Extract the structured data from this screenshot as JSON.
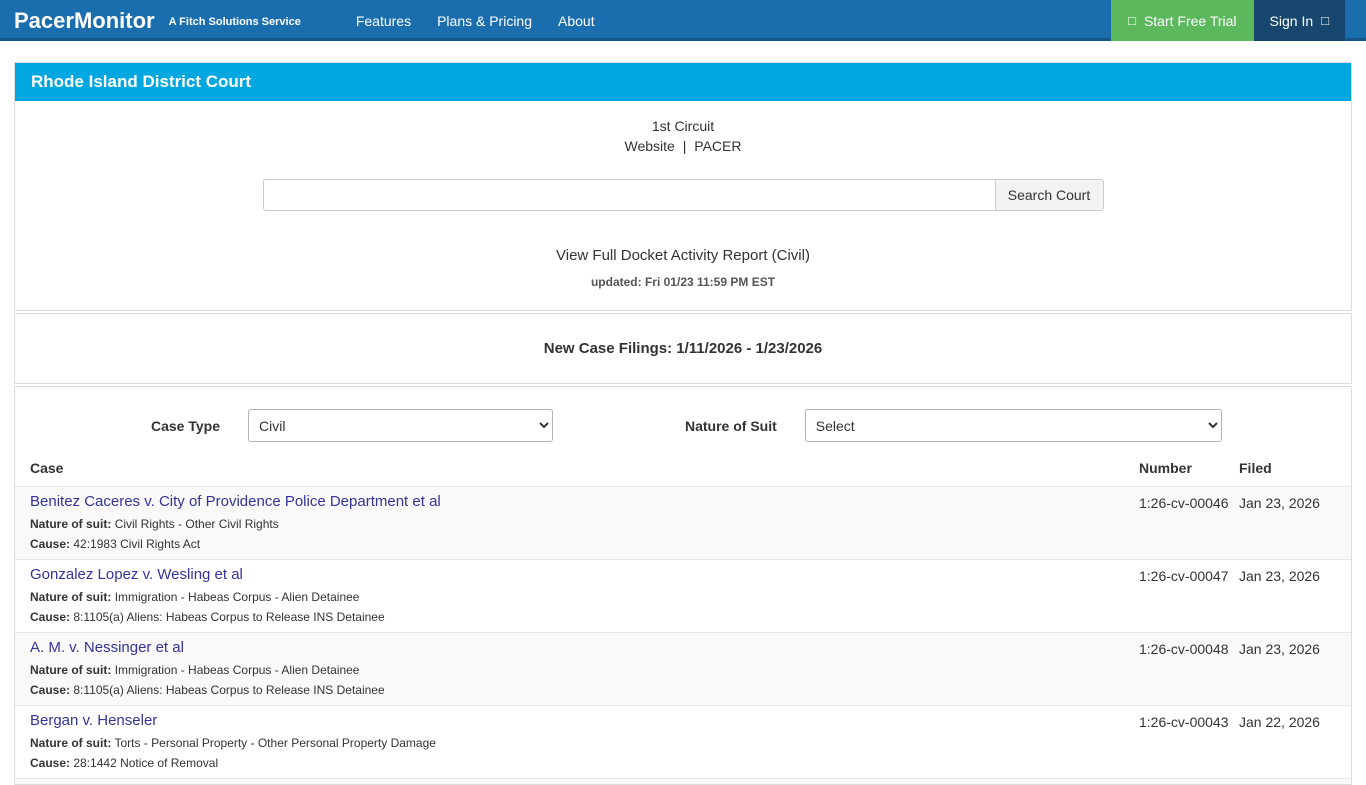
{
  "navbar": {
    "brand": "PacerMonitor",
    "tagline": "A Fitch Solutions Service",
    "links": [
      {
        "label": "Features"
      },
      {
        "label": "Plans & Pricing"
      },
      {
        "label": "About"
      }
    ],
    "trial_icon": "□",
    "trial_label": "Start Free Trial",
    "signin_label": "Sign In",
    "signin_icon": "□"
  },
  "court": {
    "name": "Rhode Island District Court",
    "circuit": "1st Circuit",
    "website_link": "Website",
    "separator": "|",
    "pacer_link": "PACER",
    "search_value": "",
    "search_button": "Search Court",
    "report_link": "View Full Docket Activity Report (Civil)",
    "updated": "updated: Fri 01/23 11:59 PM EST"
  },
  "filings": {
    "heading": "New Case Filings: 1/11/2026 - 1/23/2026",
    "case_type_label": "Case Type",
    "case_type_value": "Civil",
    "nature_label": "Nature of Suit",
    "nature_value": "Select",
    "table": {
      "columns": {
        "case": "Case",
        "number": "Number",
        "filed": "Filed"
      },
      "meta_labels": {
        "nature": "Nature of suit:",
        "cause": "Cause:"
      },
      "rows": [
        {
          "title": "Benitez Caceres v. City of Providence Police Department et al",
          "nature": "Civil Rights - Other Civil Rights",
          "cause": "42:1983 Civil Rights Act",
          "number": "1:26-cv-00046",
          "filed": "Jan 23, 2026"
        },
        {
          "title": "Gonzalez Lopez v. Wesling et al",
          "nature": "Immigration - Habeas Corpus - Alien Detainee",
          "cause": "8:1105(a) Aliens: Habeas Corpus to Release INS Detainee",
          "number": "1:26-cv-00047",
          "filed": "Jan 23, 2026"
        },
        {
          "title": "A. M. v. Nessinger et al",
          "nature": "Immigration - Habeas Corpus - Alien Detainee",
          "cause": "8:1105(a) Aliens: Habeas Corpus to Release INS Detainee",
          "number": "1:26-cv-00048",
          "filed": "Jan 23, 2026"
        },
        {
          "title": "Bergan v. Henseler",
          "nature": "Torts - Personal Property - Other Personal Property Damage",
          "cause": "28:1442 Notice of Removal",
          "number": "1:26-cv-00043",
          "filed": "Jan 22, 2026"
        }
      ]
    }
  },
  "colors": {
    "navbar_blue": "#1b6eae",
    "navbar_dark": "#17476f",
    "trial_green": "#5cb85c",
    "court_header_cyan": "#00a7e1",
    "case_link_indigo": "#333399",
    "row_stripe": "#f9f9f9",
    "border": "#dddddd",
    "text": "#333333"
  }
}
